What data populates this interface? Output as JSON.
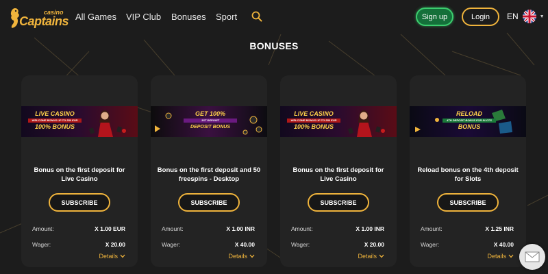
{
  "brand": {
    "logo_small": "casino",
    "logo_main": "Captains",
    "color": "#f0b43c"
  },
  "nav": {
    "items": [
      {
        "label": "All Games"
      },
      {
        "label": "VIP Club"
      },
      {
        "label": "Bonuses"
      },
      {
        "label": "Sport"
      }
    ],
    "search_icon": "search-icon"
  },
  "header": {
    "signup_label": "Sign up",
    "login_label": "Login",
    "language": "EN",
    "signup_color": "#3ccd6e",
    "login_color": "#f0b43c"
  },
  "page": {
    "title": "BONUSES"
  },
  "cards": [
    {
      "banner": {
        "line1": "LIVE CASINO",
        "line2": "WELCOME BONUS UP TO 250 EUR",
        "line3": "100% BONUS",
        "theme": "live-casino"
      },
      "title": "Bonus on the first deposit for Live Casino",
      "subscribe_label": "SUBSCRIBE",
      "amount_label": "Amount:",
      "amount_value": "X 1.00 EUR",
      "wager_label": "Wager:",
      "wager_value": "X 20.00",
      "details_label": "Details"
    },
    {
      "banner": {
        "line1": "GET 100%",
        "line2": "1ST DEPOSIT",
        "line3": "DEPOSIT BONUS",
        "theme": "deposit-bonus"
      },
      "title": "Bonus on the first deposit and 50 freespins - Desktop",
      "subscribe_label": "SUBSCRIBE",
      "amount_label": "Amount:",
      "amount_value": "X 1.00 INR",
      "wager_label": "Wager:",
      "wager_value": "X 40.00",
      "details_label": "Details"
    },
    {
      "banner": {
        "line1": "LIVE CASINO",
        "line2": "WELCOME BONUS UP TO 250 EUR",
        "line3": "100% BONUS",
        "theme": "live-casino"
      },
      "title": "Bonus on the first deposit for Live Casino",
      "subscribe_label": "SUBSCRIBE",
      "amount_label": "Amount:",
      "amount_value": "X 1.00 INR",
      "wager_label": "Wager:",
      "wager_value": "X 20.00",
      "details_label": "Details"
    },
    {
      "banner": {
        "line1": "RELOAD",
        "line2": "4TH DEPOSIT BONUS FOR SLOTS",
        "line3": "BONUS",
        "theme": "reload"
      },
      "title": "Reload bonus on the 4th deposit for Slots",
      "subscribe_label": "SUBSCRIBE",
      "amount_label": "Amount:",
      "amount_value": "X 1.25 INR",
      "wager_label": "Wager:",
      "wager_value": "X 40.00",
      "details_label": "Details"
    }
  ],
  "chat": {
    "icon": "envelope-icon"
  }
}
